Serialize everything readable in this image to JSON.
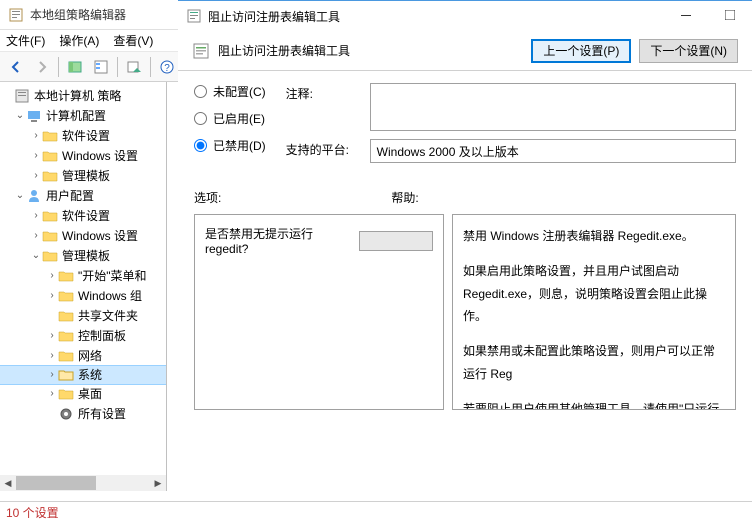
{
  "background": {
    "title": "本地组策略编辑器",
    "menu": {
      "file": "文件(F)",
      "operation": "操作(A)",
      "view": "查看(V)"
    }
  },
  "tree": {
    "root": "本地计算机 策略",
    "computer": "计算机配置",
    "user": "用户配置",
    "software": "软件设置",
    "windows": "Windows 设置",
    "admintpl": "管理模板",
    "start_menu": "\"开始\"菜单和",
    "win_group": "Windows 组",
    "shared": "共享文件夹",
    "control_panel": "控制面板",
    "network": "网络",
    "system": "系统",
    "desktop": "桌面",
    "all_settings": "所有设置"
  },
  "dialog": {
    "title": "阻止访问注册表编辑工具",
    "header": "阻止访问注册表编辑工具",
    "prev_btn": "上一个设置(P)",
    "next_btn": "下一个设置(N)",
    "radio_unset": "未配置(C)",
    "radio_enabled": "已启用(E)",
    "radio_disabled": "已禁用(D)",
    "comment_label": "注释:",
    "platform_label": "支持的平台:",
    "platform_value": "Windows 2000 及以上版本",
    "options_label": "选项:",
    "help_label": "帮助:",
    "option_question": "是否禁用无提示运行 regedit?",
    "help_p1": "禁用 Windows 注册表编辑器 Regedit.exe。",
    "help_p2": "如果启用此策略设置，并且用户试图启动 Regedit.exe，则息，说明策略设置会阻止此操作。",
    "help_p3": "如果禁用或未配置此策略设置，则用户可以正常运行 Reg",
    "help_p4": "若要阻止用户使用其他管理工具，请使用\"只运行指定的用程序\"策略设置。"
  },
  "status": {
    "count": "10 个设置"
  }
}
